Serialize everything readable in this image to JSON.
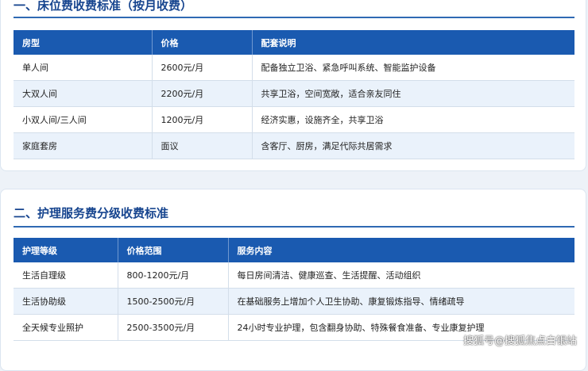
{
  "section1": {
    "title": "一、床位费收费标准（按月收费）",
    "headers": [
      "房型",
      "价格",
      "配套说明"
    ],
    "rows": [
      [
        "单人间",
        "2600元/月",
        "配备独立卫浴、紧急呼叫系统、智能监护设备"
      ],
      [
        "大双人间",
        "2200元/月",
        "共享卫浴，空间宽敞，适合亲友同住"
      ],
      [
        "小双人间/三人间",
        "1200元/月",
        "经济实惠，设施齐全，共享卫浴"
      ],
      [
        "家庭套房",
        "面议",
        "含客厅、厨房，满足代际共居需求"
      ]
    ]
  },
  "section2": {
    "title": "二、护理服务费分级收费标准",
    "headers": [
      "护理等级",
      "价格范围",
      "服务内容"
    ],
    "rows": [
      [
        "生活自理级",
        "800-1200元/月",
        "每日房间清洁、健康巡查、生活提醒、活动组织"
      ],
      [
        "生活协助级",
        "1500-2500元/月",
        "在基础服务上增加个人卫生协助、康复锻炼指导、情绪疏导"
      ],
      [
        "全天候专业照护",
        "2500-3500元/月",
        "24小时专业护理，包含翻身协助、特殊餐食准备、专业康复护理"
      ]
    ]
  },
  "watermark": "搜狐号@搜狐焦点白银站"
}
